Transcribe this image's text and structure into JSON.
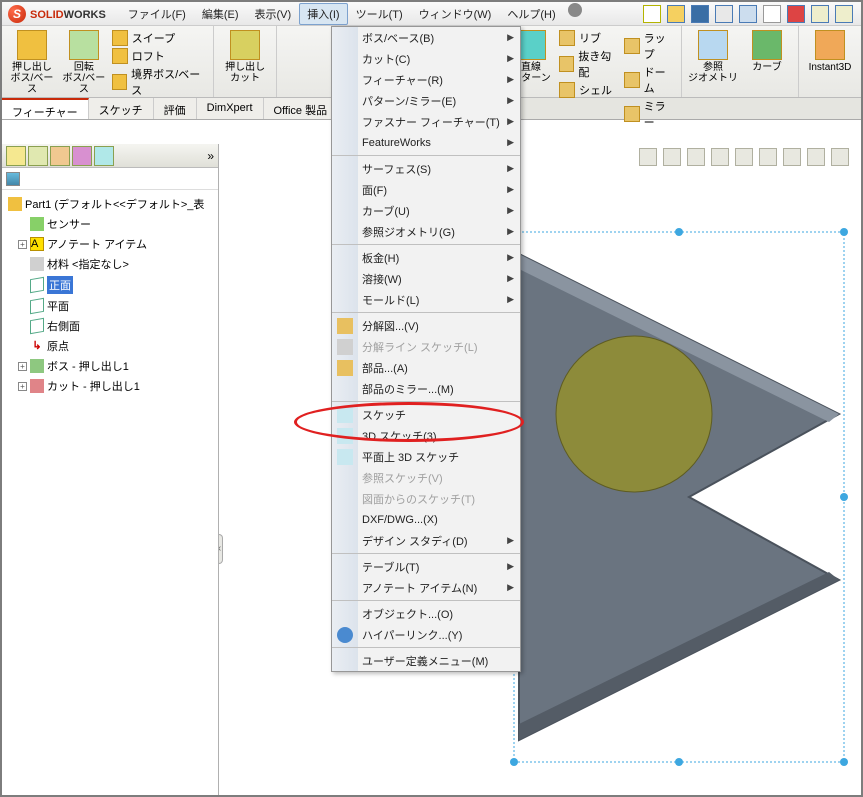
{
  "app": {
    "solid": "SOLID",
    "works": "WORKS"
  },
  "menubar": [
    "ファイル(F)",
    "編集(E)",
    "表示(V)",
    "挿入(I)",
    "ツール(T)",
    "ウィンドウ(W)",
    "ヘルプ(H)"
  ],
  "menubar_active_index": 3,
  "ribbon": {
    "g1": {
      "big1": "押し出し\nボス/ベース",
      "big2": "回転\nボス/ベース",
      "s1": "スイープ",
      "s2": "ロフト",
      "s3": "境界ボス/ベース"
    },
    "g2": {
      "big1": "押し出し\nカット"
    },
    "g3": {
      "big1": "直線\nパターン",
      "s1": "リブ",
      "s2": "抜き勾配",
      "s3": "シェル",
      "r1": "ラップ",
      "r2": "ドーム",
      "r3": "ミラー"
    },
    "g4": {
      "big1": "参照\nジオメトリ",
      "big2": "カーブ"
    },
    "g5": {
      "big1": "Instant3D"
    }
  },
  "tabs": [
    "フィーチャー",
    "スケッチ",
    "評価",
    "DimXpert",
    "Office 製品"
  ],
  "tree": {
    "root": "Part1 (デフォルト<<デフォルト>_表",
    "sensor": "センサー",
    "annot": "アノテート アイテム",
    "material": "材料 <指定なし>",
    "planes": [
      "正面",
      "平面",
      "右側面"
    ],
    "origin": "原点",
    "boss": "ボス - 押し出し1",
    "cut": "カット - 押し出し1"
  },
  "dropdown": {
    "grp1": [
      "ボス/ベース(B)",
      "カット(C)",
      "フィーチャー(R)",
      "パターン/ミラー(E)",
      "ファスナー フィーチャー(T)",
      "FeatureWorks"
    ],
    "grp2": [
      "サーフェス(S)",
      "面(F)",
      "カーブ(U)",
      "参照ジオメトリ(G)"
    ],
    "grp3": [
      "板金(H)",
      "溶接(W)",
      "モールド(L)"
    ],
    "grp4": [
      "分解図...(V)",
      "分解ライン スケッチ(L)",
      "部品...(A)",
      "部品のミラー...(M)"
    ],
    "grp4_disabled": [
      false,
      true,
      false,
      false
    ],
    "grp5": [
      "スケッチ",
      "3D スケッチ(3)",
      "平面上 3D スケッチ",
      "参照スケッチ(V)",
      "図面からのスケッチ(T)",
      "DXF/DWG...(X)",
      "デザイン スタディ(D)"
    ],
    "grp5_disabled": [
      false,
      false,
      false,
      true,
      true,
      false,
      false
    ],
    "grp6": [
      "テーブル(T)",
      "アノテート アイテム(N)"
    ],
    "grp7": [
      "オブジェクト...(O)",
      "ハイパーリンク...(Y)"
    ],
    "grp8": [
      "ユーザー定義メニュー(M)"
    ]
  }
}
